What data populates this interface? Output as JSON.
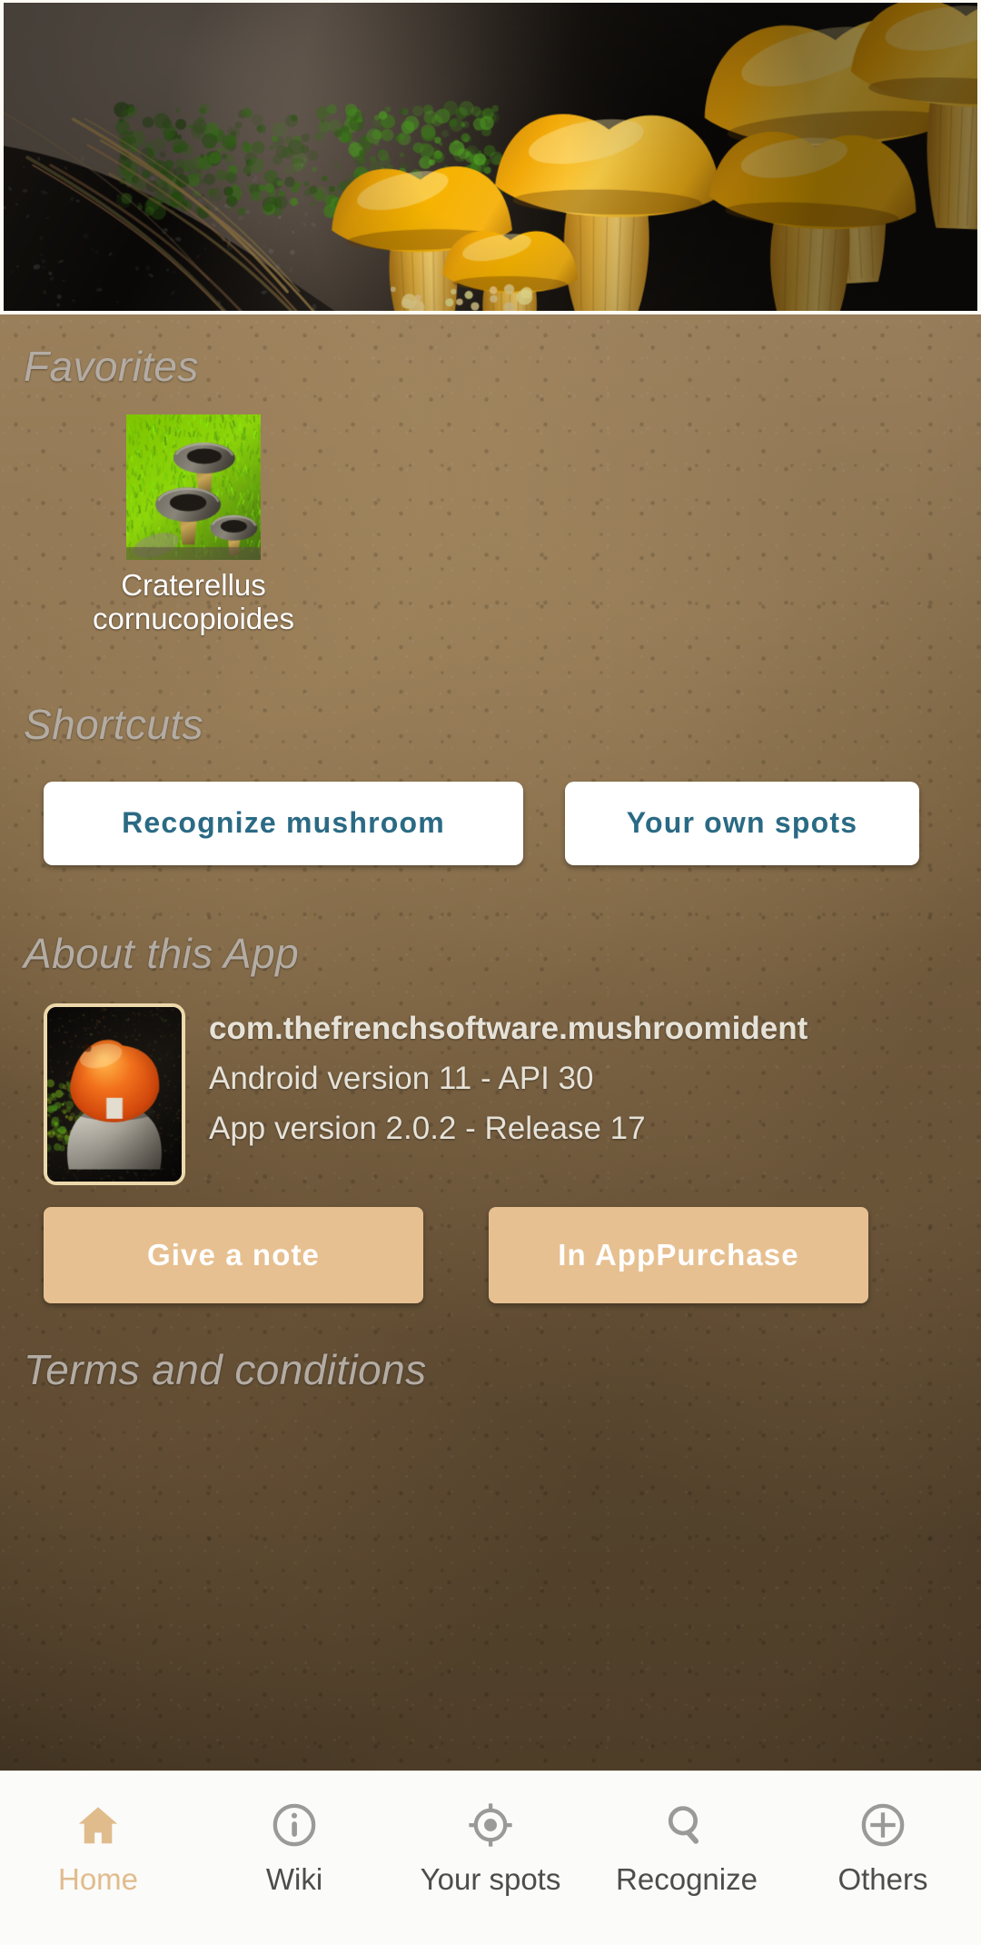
{
  "hero": {
    "name": "hero-mushroom-photo",
    "alt": "Golden chanterelle mushrooms on dark forest floor with green moss",
    "colors": {
      "cap": "#f6b300",
      "cap_light": "#ffd24a",
      "stem": "#e8a824",
      "soil": "#1b1713",
      "moss": "#5c7a24"
    }
  },
  "favorites": {
    "title": "Favorites",
    "items": [
      {
        "name": "Craterellus cornucopioides",
        "label_line1": "Craterellus",
        "label_line2": "cornucopioides",
        "thumb_alt": "Black trumpet mushrooms on bright green moss"
      }
    ]
  },
  "shortcuts": {
    "title": "Shortcuts",
    "buttons": [
      {
        "label": "Recognize mushroom"
      },
      {
        "label": "Your own spots"
      }
    ],
    "text_color": "#2a6a84",
    "bg_color": "#ffffff"
  },
  "about": {
    "title": "About this App",
    "icon_alt": "Amanita caesarea mushroom with orange cap emerging from egg",
    "package_name": "com.thefrenchsoftware.mushroomident",
    "android_version": "Android version 11 - API 30",
    "app_version": "App version 2.0.2 - Release 17",
    "buttons": [
      {
        "label": "Give a note",
        "label_line1": "Give a note",
        "label_line2": ""
      },
      {
        "label": "In App Purchase",
        "label_line1": "In App",
        "label_line2": "Purchase"
      }
    ],
    "button_bg": "#e7c091",
    "button_text": "#ffffff"
  },
  "terms": {
    "title": "Terms and conditions"
  },
  "bottom_nav": {
    "active_index": 0,
    "active_color": "#e0bc8d",
    "inactive_color": "#9a9a9a",
    "items": [
      {
        "label": "Home",
        "icon": "home-icon"
      },
      {
        "label": "Wiki",
        "icon": "info-circle-icon"
      },
      {
        "label": "Your spots",
        "icon": "crosshair-icon"
      },
      {
        "label": "Recognize",
        "icon": "search-icon"
      },
      {
        "label": "Others",
        "icon": "plus-circle-icon"
      }
    ]
  },
  "theme": {
    "background_top": "#8a7052",
    "background_bottom": "#3c2f1f",
    "section_title_color": "#b3aca4",
    "body_text_color": "#e6e2d8",
    "navbar_bg": "#fbfbf9"
  }
}
